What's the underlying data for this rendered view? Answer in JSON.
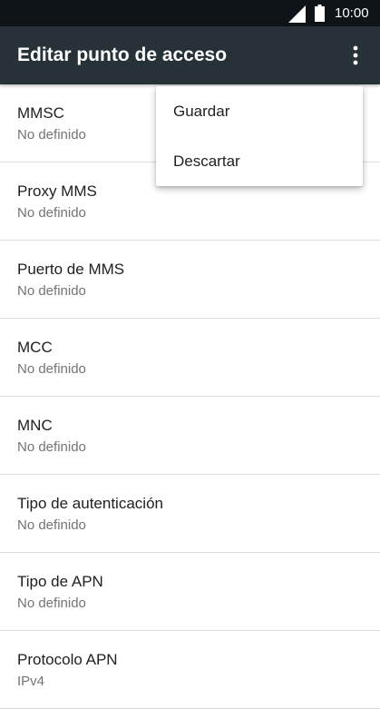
{
  "status_bar": {
    "time": "10:00",
    "signal_icon": "cell-signal-icon",
    "battery_icon": "battery-icon"
  },
  "app_bar": {
    "title": "Editar punto de acceso",
    "overflow_icon": "more-vert-icon"
  },
  "menu": {
    "items": [
      {
        "label": "Guardar"
      },
      {
        "label": "Descartar"
      }
    ]
  },
  "settings": [
    {
      "label": "MMSC",
      "value": "No definido"
    },
    {
      "label": "Proxy MMS",
      "value": "No definido"
    },
    {
      "label": "Puerto de MMS",
      "value": "No definido"
    },
    {
      "label": "MCC",
      "value": "No definido"
    },
    {
      "label": "MNC",
      "value": "No definido"
    },
    {
      "label": "Tipo de autenticación",
      "value": "No definido"
    },
    {
      "label": "Tipo de APN",
      "value": "No definido"
    },
    {
      "label": "Protocolo APN",
      "value": "IPv4"
    }
  ]
}
